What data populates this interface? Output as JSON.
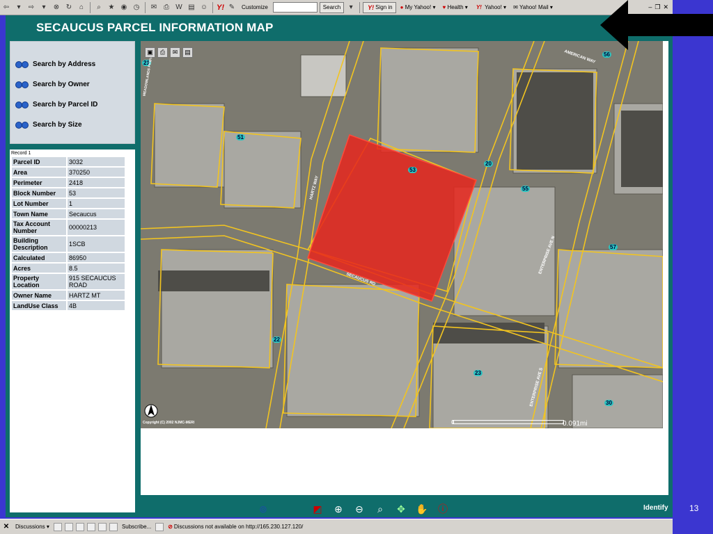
{
  "toolbar": {
    "customize": "Customize",
    "search_button": "Search",
    "sign_in": "Sign in",
    "links": [
      "My Yahoo!",
      "Health",
      "Yahoo!",
      "Yahoo! Mail"
    ]
  },
  "app": {
    "title": "SECAUCUS PARCEL INFORMATION MAP"
  },
  "search": {
    "items": [
      "Search by Address",
      "Search by Owner",
      "Search by Parcel ID",
      "Search by Size"
    ]
  },
  "record": {
    "label": "Record 1",
    "rows": [
      {
        "key": "Parcel ID",
        "value": "3032"
      },
      {
        "key": "Area",
        "value": "370250"
      },
      {
        "key": "Perimeter",
        "value": "2418"
      },
      {
        "key": "Block Number",
        "value": "53"
      },
      {
        "key": "Lot Number",
        "value": "1"
      },
      {
        "key": "Town Name",
        "value": "Secaucus"
      },
      {
        "key": "Tax Account Number",
        "value": "00000213"
      },
      {
        "key": "Building Description",
        "value": "1SCB"
      },
      {
        "key": "Calculated",
        "value": "86950"
      },
      {
        "key": "Acres",
        "value": "8.5"
      },
      {
        "key": "Property Location",
        "value": "915 SECAUCUS ROAD"
      },
      {
        "key": "Owner Name",
        "value": "HARTZ MT"
      },
      {
        "key": "LandUse Class",
        "value": "4B"
      }
    ]
  },
  "map": {
    "copyright": "Copyright (C) 2002 NJMC-MERI",
    "scale_zero": "0",
    "scale_value": "0.091mi",
    "block_labels": [
      "21",
      "51",
      "53",
      "20",
      "55",
      "56",
      "57",
      "22",
      "23",
      "30"
    ],
    "street_labels": [
      "HARTZ WAY",
      "SECAUCUS RD",
      "AMERICAN WAY",
      "ENTERPRISE AVE N",
      "ENTERPRISE AVE S",
      "MEADOWLANDS PKWY"
    ]
  },
  "bottom": {
    "identify": "Identify"
  },
  "slide_number": "13",
  "discussions": {
    "label": "Discussions",
    "subscribe": "Subscribe...",
    "status": "Discussions not available on http://165.230.127.120/"
  }
}
